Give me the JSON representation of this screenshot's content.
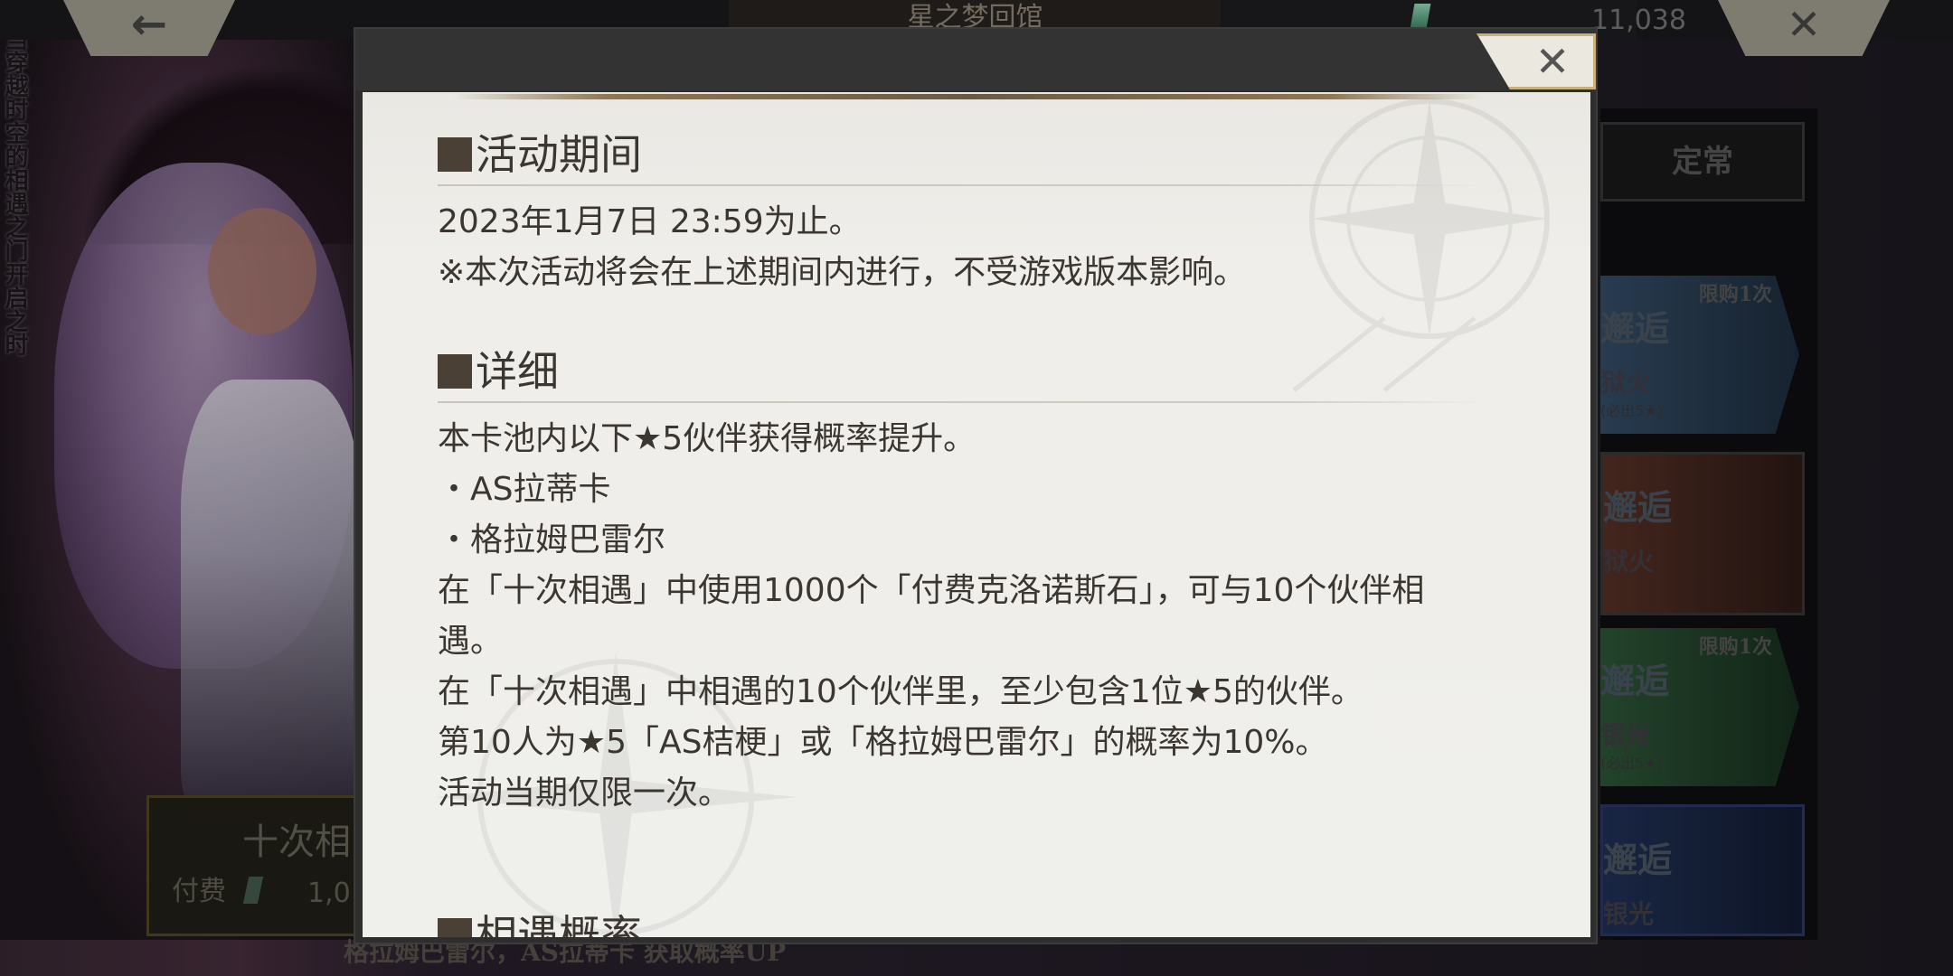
{
  "background": {
    "vertical_caption": "当穿越时空的相遇之门开启之时",
    "top_title": "星之梦回馆",
    "gem_count": "11,038",
    "back_arrow": "←",
    "close_glyph": "✕",
    "tab_regular": "定常",
    "banners": [
      {
        "limit": "限购1次",
        "title": "邂逅",
        "sub": "狱火",
        "note": "(必出5★)"
      },
      {
        "limit": "",
        "title": "邂逅",
        "sub": "狱火",
        "note": ""
      },
      {
        "limit": "限购1次",
        "title": "邂逅",
        "sub": "银光",
        "note": "(必出5★)"
      },
      {
        "limit": "",
        "title": "邂逅",
        "sub": "银光",
        "note": ""
      }
    ],
    "ten_pull_label": "十次相",
    "pay_label": "付费",
    "pay_amount": "1,0",
    "bottom_text": "格拉姆巴雷尔，AS拉蒂卡 获取概率UP"
  },
  "dialog": {
    "close_glyph": "✕",
    "sections": [
      {
        "title": "活动期间",
        "lines": [
          "2023年1月7日 23:59为止。",
          "※本次活动将会在上述期间内进行，不受游戏版本影响。"
        ]
      },
      {
        "title": "详细",
        "lines": [
          "本卡池内以下★5伙伴获得概率提升。",
          "・AS拉蒂卡",
          "・格拉姆巴雷尔",
          "在「十次相遇」中使用1000个「付费克洛诺斯石」，可与10个伙伴相",
          "遇。",
          "在「十次相遇」中相遇的10个伙伴里，至少包含1位★5的伙伴。",
          "第10人为★5「AS桔梗」或「格拉姆巴雷尔」的概率为10%。",
          "活动当期仅限一次。"
        ]
      },
      {
        "title": "相遇概率",
        "lines": []
      }
    ]
  }
}
